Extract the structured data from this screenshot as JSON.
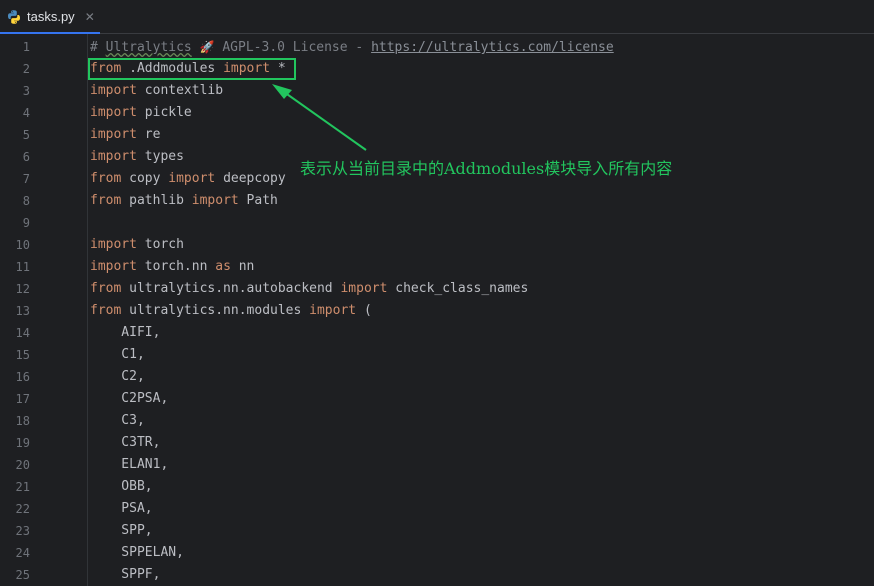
{
  "tab": {
    "file_name": "tasks.py",
    "close_glyph": "✕",
    "icon": "python-file-icon"
  },
  "editor": {
    "line_numbers": [
      "1",
      "2",
      "3",
      "4",
      "5",
      "6",
      "7",
      "8",
      "9",
      "10",
      "11",
      "12",
      "13",
      "14",
      "15",
      "16",
      "17",
      "18",
      "19",
      "20",
      "21",
      "22",
      "23",
      "24",
      "25"
    ],
    "lines": [
      {
        "segments": [
          {
            "t": "# ",
            "c": "cm"
          },
          {
            "t": "Ultralytics",
            "c": "squig"
          },
          {
            "t": " ",
            "c": "cm"
          },
          {
            "t": "🚀",
            "c": "rocket"
          },
          {
            "t": " AGPL-3.0 License - ",
            "c": "cm"
          },
          {
            "t": "https://ultralytics.com/license",
            "c": "url"
          }
        ]
      },
      {
        "segments": [
          {
            "t": "from",
            "c": "kw"
          },
          {
            "t": " .Addmodules ",
            "c": ""
          },
          {
            "t": "import",
            "c": "kw"
          },
          {
            "t": " *",
            "c": ""
          }
        ]
      },
      {
        "segments": [
          {
            "t": "import",
            "c": "kw"
          },
          {
            "t": " contextlib",
            "c": ""
          }
        ]
      },
      {
        "segments": [
          {
            "t": "import",
            "c": "kw"
          },
          {
            "t": " pickle",
            "c": ""
          }
        ]
      },
      {
        "segments": [
          {
            "t": "import",
            "c": "kw"
          },
          {
            "t": " re",
            "c": ""
          }
        ]
      },
      {
        "segments": [
          {
            "t": "import",
            "c": "kw"
          },
          {
            "t": " types",
            "c": ""
          }
        ]
      },
      {
        "segments": [
          {
            "t": "from",
            "c": "kw"
          },
          {
            "t": " copy ",
            "c": ""
          },
          {
            "t": "import",
            "c": "kw"
          },
          {
            "t": " deepcopy",
            "c": ""
          }
        ]
      },
      {
        "segments": [
          {
            "t": "from",
            "c": "kw"
          },
          {
            "t": " pathlib ",
            "c": ""
          },
          {
            "t": "import",
            "c": "kw"
          },
          {
            "t": " Path",
            "c": ""
          }
        ]
      },
      {
        "segments": []
      },
      {
        "segments": [
          {
            "t": "import",
            "c": "kw"
          },
          {
            "t": " torch",
            "c": ""
          }
        ]
      },
      {
        "segments": [
          {
            "t": "import",
            "c": "kw"
          },
          {
            "t": " torch.nn ",
            "c": ""
          },
          {
            "t": "as",
            "c": "kw"
          },
          {
            "t": " nn",
            "c": ""
          }
        ]
      },
      {
        "segments": [
          {
            "t": "from",
            "c": "kw"
          },
          {
            "t": " ultralytics.nn.autobackend ",
            "c": ""
          },
          {
            "t": "import",
            "c": "kw"
          },
          {
            "t": " check_class_names",
            "c": ""
          }
        ]
      },
      {
        "segments": [
          {
            "t": "from",
            "c": "kw"
          },
          {
            "t": " ultralytics.nn.modules ",
            "c": ""
          },
          {
            "t": "import",
            "c": "kw"
          },
          {
            "t": " (",
            "c": ""
          }
        ]
      },
      {
        "segments": [
          {
            "t": "    AIFI,",
            "c": ""
          }
        ]
      },
      {
        "segments": [
          {
            "t": "    C1,",
            "c": ""
          }
        ]
      },
      {
        "segments": [
          {
            "t": "    C2,",
            "c": ""
          }
        ]
      },
      {
        "segments": [
          {
            "t": "    C2PSA,",
            "c": ""
          }
        ]
      },
      {
        "segments": [
          {
            "t": "    C3,",
            "c": ""
          }
        ]
      },
      {
        "segments": [
          {
            "t": "    C3TR,",
            "c": ""
          }
        ]
      },
      {
        "segments": [
          {
            "t": "    ELAN1,",
            "c": ""
          }
        ]
      },
      {
        "segments": [
          {
            "t": "    OBB,",
            "c": ""
          }
        ]
      },
      {
        "segments": [
          {
            "t": "    PSA,",
            "c": ""
          }
        ]
      },
      {
        "segments": [
          {
            "t": "    SPP,",
            "c": ""
          }
        ]
      },
      {
        "segments": [
          {
            "t": "    SPPELAN,",
            "c": ""
          }
        ]
      },
      {
        "segments": [
          {
            "t": "    SPPF,",
            "c": ""
          }
        ]
      }
    ]
  },
  "annotation": {
    "text": "表示从当前目录中的Addmodules模块导入所有内容",
    "color": "#22c55e"
  },
  "colors": {
    "keyword": "#cf8e6d",
    "comment": "#7a7e85",
    "text": "#bcbec4",
    "background": "#1e1f22",
    "annotation_green": "#22c55e"
  }
}
